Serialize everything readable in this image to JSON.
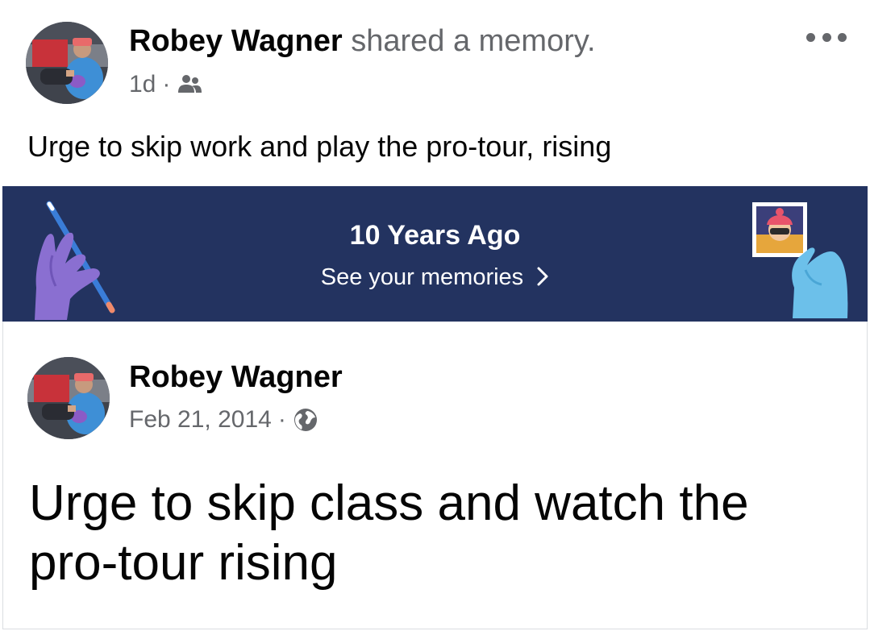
{
  "post": {
    "author": "Robey Wagner",
    "action": "shared a memory.",
    "time": "1d",
    "separator": "·",
    "audience_icon": "friends-icon",
    "text": "Urge to skip work and play the pro-tour, rising",
    "more_icon": "more-options-icon"
  },
  "memory_banner": {
    "title": "10 Years Ago",
    "link_label": "See your memories",
    "chevron_icon": "chevron-right-icon",
    "colors": {
      "background": "#233360",
      "left_hand": "#8a6fd1",
      "right_hand": "#6cc0ea"
    }
  },
  "original_post": {
    "author": "Robey Wagner",
    "date": "Feb 21, 2014",
    "separator": "·",
    "audience_icon": "globe-icon",
    "text": "Urge to skip class and watch the pro-tour rising"
  }
}
